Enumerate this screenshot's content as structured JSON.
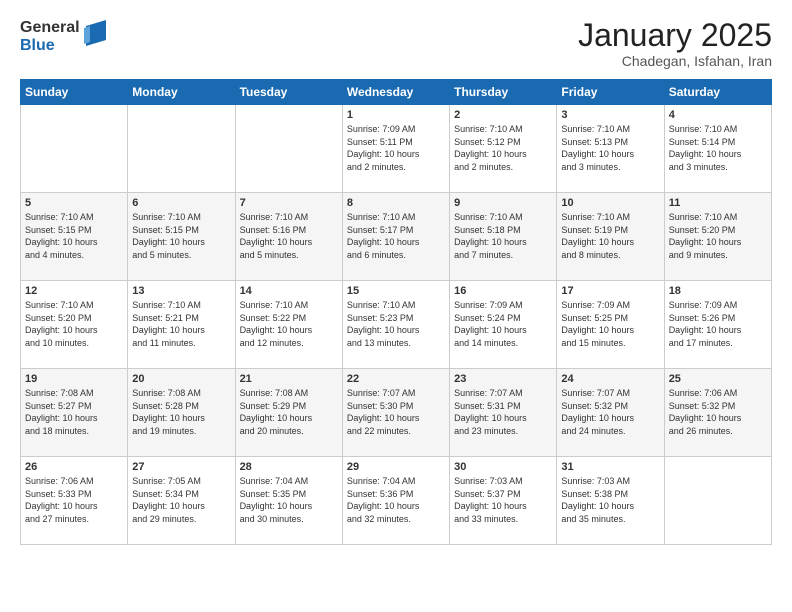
{
  "header": {
    "logo_general": "General",
    "logo_blue": "Blue",
    "title": "January 2025",
    "location": "Chadegan, Isfahan, Iran"
  },
  "weekdays": [
    "Sunday",
    "Monday",
    "Tuesday",
    "Wednesday",
    "Thursday",
    "Friday",
    "Saturday"
  ],
  "weeks": [
    [
      {
        "day": "",
        "content": ""
      },
      {
        "day": "",
        "content": ""
      },
      {
        "day": "",
        "content": ""
      },
      {
        "day": "1",
        "content": "Sunrise: 7:09 AM\nSunset: 5:11 PM\nDaylight: 10 hours\nand 2 minutes."
      },
      {
        "day": "2",
        "content": "Sunrise: 7:10 AM\nSunset: 5:12 PM\nDaylight: 10 hours\nand 2 minutes."
      },
      {
        "day": "3",
        "content": "Sunrise: 7:10 AM\nSunset: 5:13 PM\nDaylight: 10 hours\nand 3 minutes."
      },
      {
        "day": "4",
        "content": "Sunrise: 7:10 AM\nSunset: 5:14 PM\nDaylight: 10 hours\nand 3 minutes."
      }
    ],
    [
      {
        "day": "5",
        "content": "Sunrise: 7:10 AM\nSunset: 5:15 PM\nDaylight: 10 hours\nand 4 minutes."
      },
      {
        "day": "6",
        "content": "Sunrise: 7:10 AM\nSunset: 5:15 PM\nDaylight: 10 hours\nand 5 minutes."
      },
      {
        "day": "7",
        "content": "Sunrise: 7:10 AM\nSunset: 5:16 PM\nDaylight: 10 hours\nand 5 minutes."
      },
      {
        "day": "8",
        "content": "Sunrise: 7:10 AM\nSunset: 5:17 PM\nDaylight: 10 hours\nand 6 minutes."
      },
      {
        "day": "9",
        "content": "Sunrise: 7:10 AM\nSunset: 5:18 PM\nDaylight: 10 hours\nand 7 minutes."
      },
      {
        "day": "10",
        "content": "Sunrise: 7:10 AM\nSunset: 5:19 PM\nDaylight: 10 hours\nand 8 minutes."
      },
      {
        "day": "11",
        "content": "Sunrise: 7:10 AM\nSunset: 5:20 PM\nDaylight: 10 hours\nand 9 minutes."
      }
    ],
    [
      {
        "day": "12",
        "content": "Sunrise: 7:10 AM\nSunset: 5:20 PM\nDaylight: 10 hours\nand 10 minutes."
      },
      {
        "day": "13",
        "content": "Sunrise: 7:10 AM\nSunset: 5:21 PM\nDaylight: 10 hours\nand 11 minutes."
      },
      {
        "day": "14",
        "content": "Sunrise: 7:10 AM\nSunset: 5:22 PM\nDaylight: 10 hours\nand 12 minutes."
      },
      {
        "day": "15",
        "content": "Sunrise: 7:10 AM\nSunset: 5:23 PM\nDaylight: 10 hours\nand 13 minutes."
      },
      {
        "day": "16",
        "content": "Sunrise: 7:09 AM\nSunset: 5:24 PM\nDaylight: 10 hours\nand 14 minutes."
      },
      {
        "day": "17",
        "content": "Sunrise: 7:09 AM\nSunset: 5:25 PM\nDaylight: 10 hours\nand 15 minutes."
      },
      {
        "day": "18",
        "content": "Sunrise: 7:09 AM\nSunset: 5:26 PM\nDaylight: 10 hours\nand 17 minutes."
      }
    ],
    [
      {
        "day": "19",
        "content": "Sunrise: 7:08 AM\nSunset: 5:27 PM\nDaylight: 10 hours\nand 18 minutes."
      },
      {
        "day": "20",
        "content": "Sunrise: 7:08 AM\nSunset: 5:28 PM\nDaylight: 10 hours\nand 19 minutes."
      },
      {
        "day": "21",
        "content": "Sunrise: 7:08 AM\nSunset: 5:29 PM\nDaylight: 10 hours\nand 20 minutes."
      },
      {
        "day": "22",
        "content": "Sunrise: 7:07 AM\nSunset: 5:30 PM\nDaylight: 10 hours\nand 22 minutes."
      },
      {
        "day": "23",
        "content": "Sunrise: 7:07 AM\nSunset: 5:31 PM\nDaylight: 10 hours\nand 23 minutes."
      },
      {
        "day": "24",
        "content": "Sunrise: 7:07 AM\nSunset: 5:32 PM\nDaylight: 10 hours\nand 24 minutes."
      },
      {
        "day": "25",
        "content": "Sunrise: 7:06 AM\nSunset: 5:32 PM\nDaylight: 10 hours\nand 26 minutes."
      }
    ],
    [
      {
        "day": "26",
        "content": "Sunrise: 7:06 AM\nSunset: 5:33 PM\nDaylight: 10 hours\nand 27 minutes."
      },
      {
        "day": "27",
        "content": "Sunrise: 7:05 AM\nSunset: 5:34 PM\nDaylight: 10 hours\nand 29 minutes."
      },
      {
        "day": "28",
        "content": "Sunrise: 7:04 AM\nSunset: 5:35 PM\nDaylight: 10 hours\nand 30 minutes."
      },
      {
        "day": "29",
        "content": "Sunrise: 7:04 AM\nSunset: 5:36 PM\nDaylight: 10 hours\nand 32 minutes."
      },
      {
        "day": "30",
        "content": "Sunrise: 7:03 AM\nSunset: 5:37 PM\nDaylight: 10 hours\nand 33 minutes."
      },
      {
        "day": "31",
        "content": "Sunrise: 7:03 AM\nSunset: 5:38 PM\nDaylight: 10 hours\nand 35 minutes."
      },
      {
        "day": "",
        "content": ""
      }
    ]
  ]
}
